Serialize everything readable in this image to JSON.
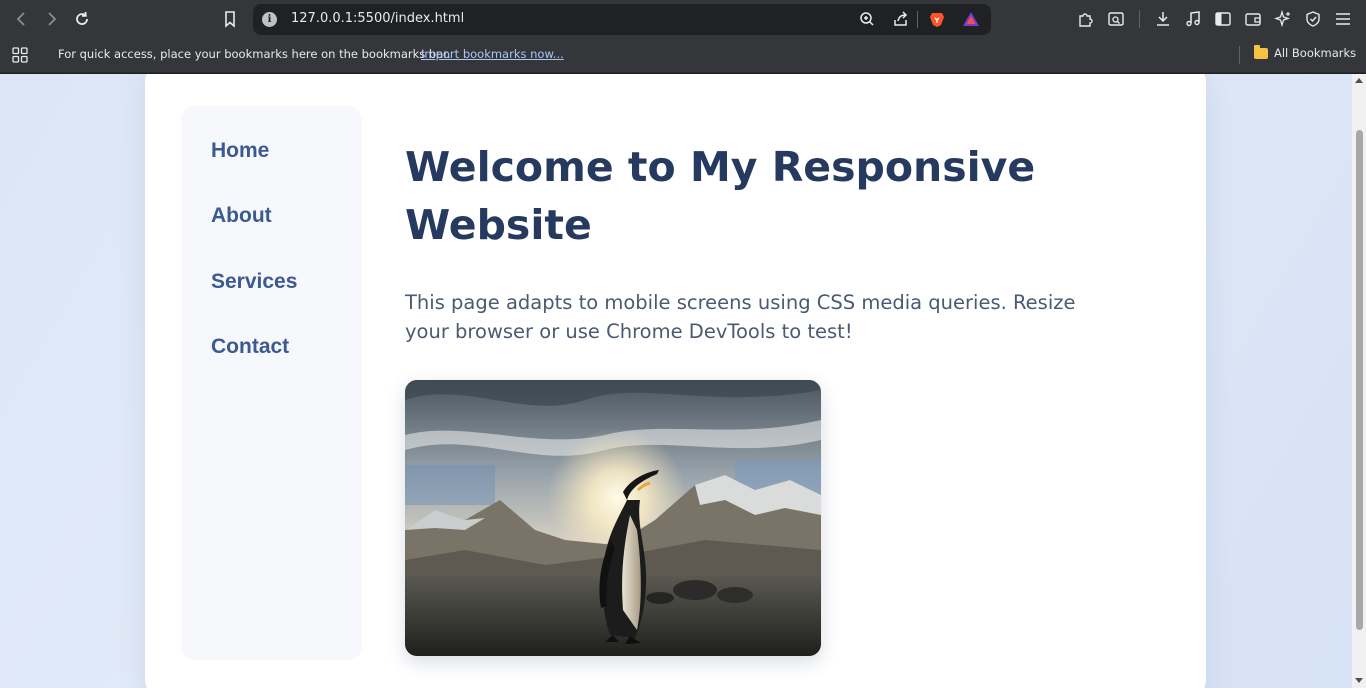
{
  "browser": {
    "url": "127.0.0.1:5500/index.html",
    "info_glyph": "i"
  },
  "bookmarks_bar": {
    "prompt": "For quick access, place your bookmarks here on the bookmarks bar.",
    "import_link": "Import bookmarks now...",
    "all_bookmarks": "All Bookmarks"
  },
  "nav": {
    "items": [
      {
        "label": "Home"
      },
      {
        "label": "About"
      },
      {
        "label": "Services"
      },
      {
        "label": "Contact"
      }
    ]
  },
  "main": {
    "title": "Welcome to My Responsive Website",
    "description": "This page adapts to mobile screens using CSS media queries. Resize your browser or use Chrome DevTools to test!",
    "image_subject": "penguin-on-beach-with-mountains"
  },
  "colors": {
    "nav_text": "#3a5a91",
    "heading": "#253a5e",
    "body_text": "#4b5a70",
    "page_bg": "#dce6f7",
    "card_bg": "#ffffff"
  }
}
